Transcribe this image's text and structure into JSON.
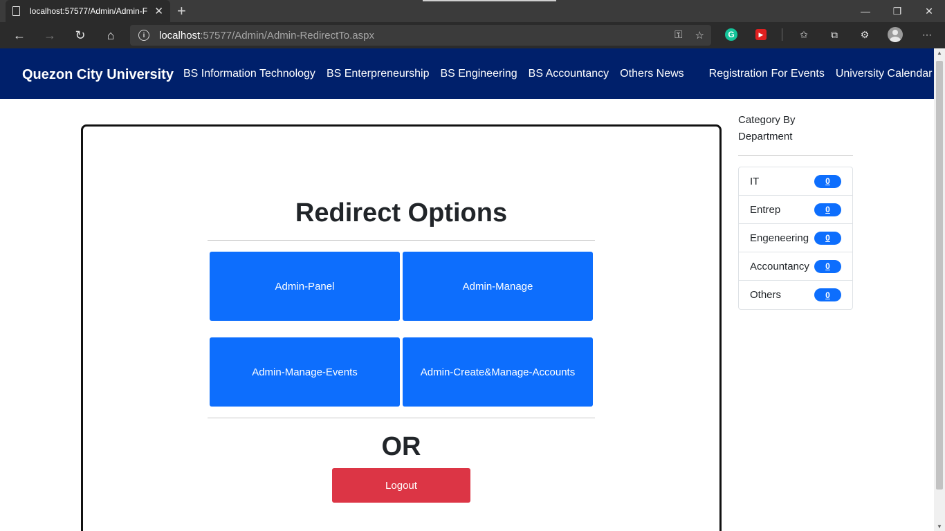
{
  "browser": {
    "tab_title": "localhost:57577/Admin/Admin-F",
    "url_host": "localhost",
    "url_path": ":57577/Admin/Admin-RedirectTo.aspx"
  },
  "site": {
    "brand": "Quezon City University",
    "nav": [
      "BS Information Technology",
      "BS Enterpreneurship",
      "BS Engineering",
      "BS Accountancy",
      "Others News",
      "Registration For Events",
      "University Calendar"
    ]
  },
  "main": {
    "title": "Redirect Options",
    "buttons": [
      "Admin-Panel",
      "Admin-Manage",
      "Admin-Manage-Events",
      "Admin-Create&Manage-Accounts"
    ],
    "or_text": "OR",
    "logout": "Logout"
  },
  "sidebar": {
    "heading": "Category By Department",
    "categories": [
      {
        "label": "IT",
        "count": "0"
      },
      {
        "label": "Entrep",
        "count": "0"
      },
      {
        "label": "Engeneering",
        "count": "0"
      },
      {
        "label": "Accountancy",
        "count": "0"
      },
      {
        "label": "Others",
        "count": "0"
      }
    ]
  },
  "colors": {
    "navbar": "#00206b",
    "primary": "#0d6efd",
    "danger": "#dc3545"
  }
}
